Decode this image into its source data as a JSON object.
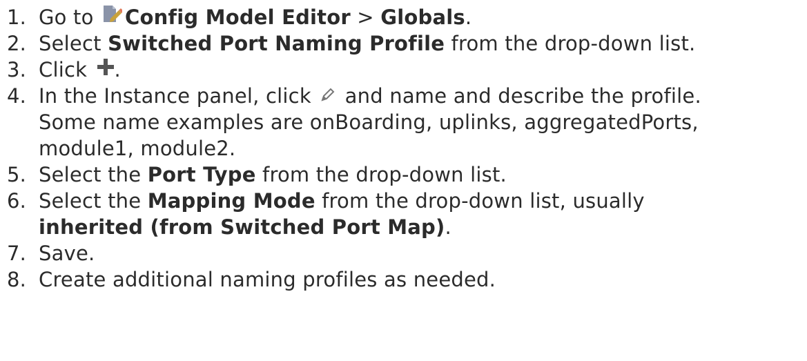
{
  "steps": [
    {
      "num": "1.",
      "parts": [
        {
          "t": "Go to ",
          "b": false
        },
        {
          "icon": "editor-icon"
        },
        {
          "t": "Config Model Editor",
          "b": true
        },
        {
          "t": " > ",
          "b": false
        },
        {
          "t": "Globals",
          "b": true
        },
        {
          "t": ".",
          "b": false
        }
      ]
    },
    {
      "num": "2.",
      "parts": [
        {
          "t": "Select ",
          "b": false
        },
        {
          "t": "Switched Port Naming Profile",
          "b": true
        },
        {
          "t": " from the drop-down list.",
          "b": false
        }
      ]
    },
    {
      "num": "3.",
      "parts": [
        {
          "t": "Click ",
          "b": false
        },
        {
          "icon": "plus-icon"
        },
        {
          "t": ".",
          "b": false
        }
      ]
    },
    {
      "num": "4.",
      "parts": [
        {
          "t": "In the Instance panel, click ",
          "b": false
        },
        {
          "icon": "pencil-icon"
        },
        {
          "t": " and name and describe the profile.",
          "b": false
        },
        {
          "br": true
        },
        {
          "t": "Some name examples are onBoarding, uplinks, aggregatedPorts,",
          "b": false
        },
        {
          "br": true
        },
        {
          "t": "module1, module2.",
          "b": false
        }
      ]
    },
    {
      "num": "5.",
      "parts": [
        {
          "t": "Select the ",
          "b": false
        },
        {
          "t": "Port Type",
          "b": true
        },
        {
          "t": " from the drop-down list.",
          "b": false
        }
      ]
    },
    {
      "num": "6.",
      "parts": [
        {
          "t": "Select the ",
          "b": false
        },
        {
          "t": "Mapping Mode",
          "b": true
        },
        {
          "t": " from the drop-down list, usually",
          "b": false
        },
        {
          "br": true
        },
        {
          "t": "inherited (from Switched Port Map)",
          "b": true
        },
        {
          "t": ".",
          "b": false
        }
      ]
    },
    {
      "num": "7.",
      "parts": [
        {
          "t": "Save.",
          "b": false
        }
      ]
    },
    {
      "num": "8.",
      "parts": [
        {
          "t": "Create additional naming profiles as needed.",
          "b": false
        }
      ]
    }
  ]
}
